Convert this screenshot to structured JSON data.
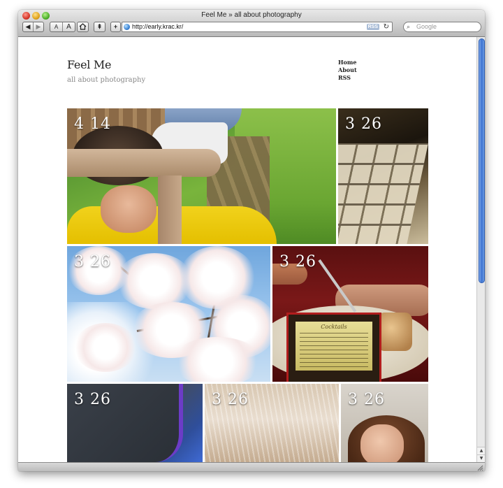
{
  "window": {
    "title": "Feel Me » all about photography"
  },
  "toolbar": {
    "back_label": "◀",
    "forward_label": "▶",
    "text_smaller_label": "A",
    "text_bigger_label": "A",
    "home_icon": "home-icon",
    "snapback_label": "⇞",
    "add_bookmark_label": "+"
  },
  "address": {
    "url": "http://early.krac.kr/",
    "rss_label": "RSS",
    "reload_icon": "reload-icon"
  },
  "search": {
    "placeholder": "Google"
  },
  "site": {
    "title": "Feel Me",
    "subtitle": "all about photography",
    "nav": [
      "Home",
      "About",
      "RSS"
    ]
  },
  "posts": [
    {
      "date": "4 14",
      "subject": "girl-on-bench"
    },
    {
      "date": "3 26",
      "subject": "keyboard"
    },
    {
      "date": "3 26",
      "subject": "cherry-blossoms"
    },
    {
      "date": "3 26",
      "subject": "cocktail-menu"
    },
    {
      "date": "3 26",
      "subject": "phone"
    },
    {
      "date": "3 26",
      "subject": "fur"
    },
    {
      "date": "3 26",
      "subject": "woman-smiling"
    }
  ],
  "menu_card": {
    "title": "Cocktails"
  }
}
